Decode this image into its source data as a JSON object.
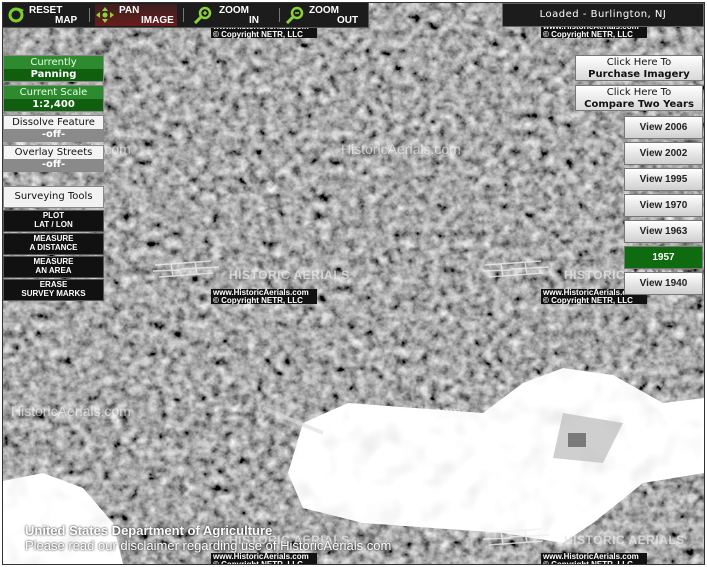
{
  "toolbar": {
    "reset": {
      "l1": "RESET",
      "l2": "MAP"
    },
    "pan": {
      "l1": "PAN",
      "l2": "IMAGE"
    },
    "zoom_in": {
      "l1": "ZOOM",
      "l2": "IN"
    },
    "zoom_out": {
      "l1": "ZOOM",
      "l2": "OUT"
    }
  },
  "status": {
    "text": "Loaded - Burlington, NJ"
  },
  "left_panel": {
    "currently": {
      "label": "Currently",
      "value": "Panning"
    },
    "scale": {
      "label": "Current Scale",
      "value": "1:2,400"
    },
    "dissolve": {
      "label": "Dissolve Feature",
      "value": "-off-"
    },
    "overlay": {
      "label": "Overlay Streets",
      "value": "-off-"
    },
    "surveying": {
      "title": "Surveying Tools",
      "tools": [
        {
          "l1": "PLOT",
          "l2": "LAT / LON"
        },
        {
          "l1": "MEASURE",
          "l2": "A DISTANCE"
        },
        {
          "l1": "MEASURE",
          "l2": "AN AREA"
        },
        {
          "l1": "ERASE",
          "l2": "SURVEY MARKS"
        }
      ]
    }
  },
  "right_panel": {
    "purchase": {
      "l1": "Click Here To",
      "l2": "Purchase Imagery"
    },
    "compare": {
      "l1": "Click Here To",
      "l2": "Compare Two Years"
    },
    "years": [
      {
        "label": "View 2006",
        "selected": false
      },
      {
        "label": "View 2002",
        "selected": false
      },
      {
        "label": "View 1995",
        "selected": false
      },
      {
        "label": "View 1970",
        "selected": false
      },
      {
        "label": "View 1963",
        "selected": false
      },
      {
        "label": "1957",
        "selected": true
      },
      {
        "label": "View 1940",
        "selected": false
      }
    ]
  },
  "watermarks": {
    "site": "HistoricAerials.com",
    "logo": "HISTORIC AERIALS",
    "copy_l1": "www.HistoricAerials.com",
    "copy_l2": "© Copyright NETR, LLC"
  },
  "footer": {
    "agency": "United States Department of Agriculture",
    "disclaimer": "Please read our disclaimer regarding use of HistoricAerials.com"
  },
  "colors": {
    "selected_year": "#0f6b0f",
    "panel_green": "#2e8a2e",
    "toolbar": "#1c1c1c"
  }
}
